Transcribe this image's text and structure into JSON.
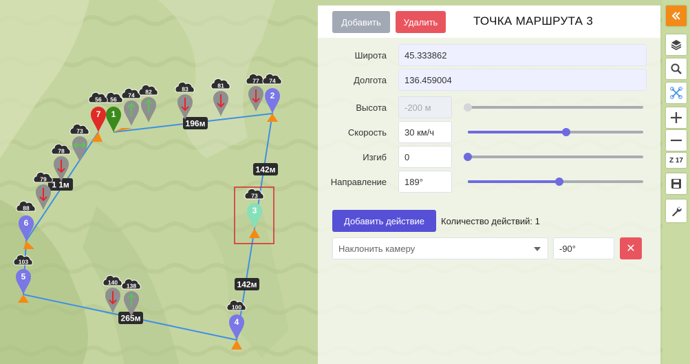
{
  "map": {
    "segment_labels": [
      {
        "id": "1-2",
        "text": "196м"
      },
      {
        "id": "2-3",
        "text": "142м"
      },
      {
        "id": "3-4",
        "text": "142м"
      },
      {
        "id": "4-5",
        "text": "265м"
      },
      {
        "id": "6-7",
        "text": "1 1м"
      }
    ],
    "waypoints": [
      {
        "n": "1",
        "badge": "56",
        "color": "#3a8a1c"
      },
      {
        "n": "2",
        "badge": "74",
        "color": "#7a77e6"
      },
      {
        "n": "3",
        "badge": "73",
        "color": "#86e0b9"
      },
      {
        "n": "4",
        "badge": "100",
        "color": "#7a77e6"
      },
      {
        "n": "5",
        "badge": "103",
        "color": "#7a77e6"
      },
      {
        "n": "6",
        "badge": "88",
        "color": "#7a77e6"
      },
      {
        "n": "7",
        "badge": "56",
        "color": "#e02a25"
      }
    ],
    "pois": [
      {
        "badge": "74",
        "dir": "up"
      },
      {
        "badge": "82",
        "dir": "up"
      },
      {
        "badge": "83",
        "dir": "down"
      },
      {
        "badge": "81",
        "dir": "down"
      },
      {
        "badge": "77",
        "dir": "down"
      },
      {
        "badge": "73",
        "dir": "horizontal"
      },
      {
        "badge": "78",
        "dir": "down"
      },
      {
        "badge": "79",
        "dir": "down"
      },
      {
        "badge": "140",
        "dir": "down"
      },
      {
        "badge": "138",
        "dir": "up"
      }
    ]
  },
  "panel": {
    "add_label": "Добавить",
    "delete_label": "Удалить",
    "title": "ТОЧКА МАРШРУТА 3",
    "latitude_label": "Широта",
    "latitude_value": "45.333862",
    "longitude_label": "Долгота",
    "longitude_value": "136.459004",
    "height_label": "Высота",
    "height_placeholder": "-200 м",
    "height_level": 0,
    "speed_label": "Скорость",
    "speed_value": "30 км/ч",
    "speed_level": 0.56,
    "bend_label": "Изгиб",
    "bend_value": "0",
    "bend_level": 0,
    "direction_label": "Направление",
    "direction_value": "189°",
    "direction_level": 0.52,
    "add_action_label": "Добавить действие",
    "action_count_text": "Количество действий: 1",
    "action_select_value": "Наклонить камеру",
    "action_param_value": "-90°",
    "remove_action_symbol": "✕"
  },
  "toolbar": {
    "zoom_label": "Z 17",
    "icons": [
      "collapse-icon",
      "layers-icon",
      "search-icon",
      "drone-icon",
      "zoom-in-icon",
      "zoom-out-icon",
      "save-icon",
      "wrench-icon"
    ]
  },
  "colors": {
    "route_line": "#3d8fe6",
    "waypoint_default": "#7a77e6",
    "selected_frame": "#d9262a",
    "heading_arrow": "#f58a13",
    "accent_button": "#5550d6",
    "danger_button": "#e9555f"
  }
}
